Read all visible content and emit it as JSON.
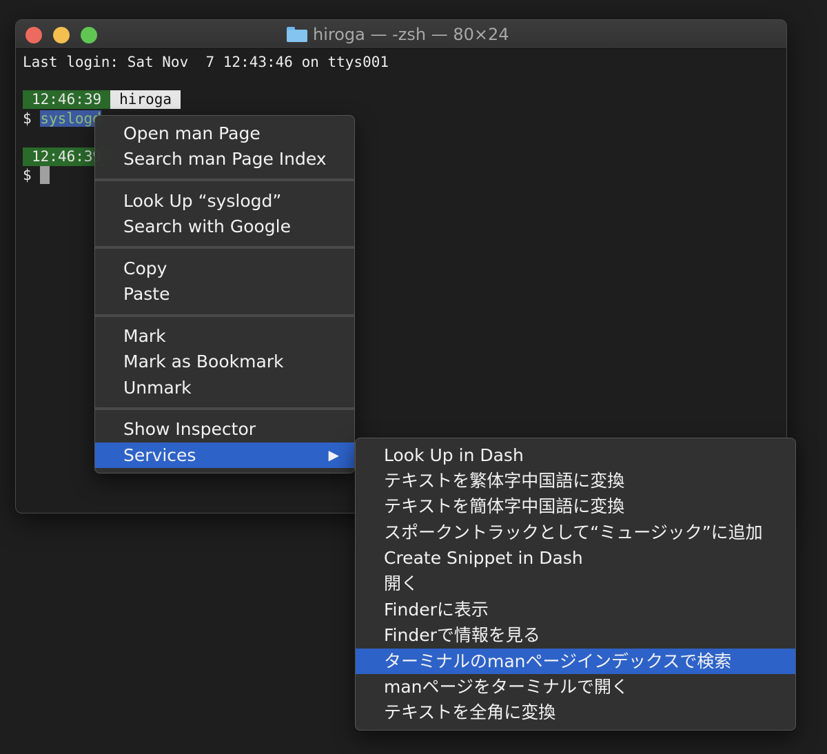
{
  "window": {
    "title": "hiroga — -zsh — 80×24",
    "title_icon": "folder-icon"
  },
  "terminal": {
    "last_login": "Last login: Sat Nov  7 12:43:46 on ttys001",
    "prompt1": {
      "time": "12:46:39",
      "user": "hiroga",
      "symbol": "$",
      "command": "syslogd"
    },
    "prompt2": {
      "time": "12:46:39",
      "symbol": "$"
    }
  },
  "context_menu": {
    "groups": [
      [
        "Open man Page",
        "Search man Page Index"
      ],
      [
        "Look Up “syslogd”",
        "Search with Google"
      ],
      [
        "Copy",
        "Paste"
      ],
      [
        "Mark",
        "Mark as Bookmark",
        "Unmark"
      ],
      [
        "Show Inspector",
        "Services"
      ]
    ],
    "highlighted": "Services",
    "submenu_arrow": "▶"
  },
  "services_menu": {
    "items": [
      "Look Up in Dash",
      "テキストを繁体字中国語に変換",
      "テキストを簡体字中国語に変換",
      "スポークントラックとして“ミュージック”に追加",
      "Create Snippet in Dash",
      "開く",
      "Finderに表示",
      "Finderで情報を見る",
      "ターミナルのmanページインデックスで検索",
      "manページをターミナルで開く",
      "テキストを全角に変換"
    ],
    "highlighted": "ターミナルのmanページインデックスで検索"
  },
  "colors": {
    "highlight": "#2d62c8",
    "time_segment": "#2a6a2a",
    "background": "#1e1e1e"
  }
}
